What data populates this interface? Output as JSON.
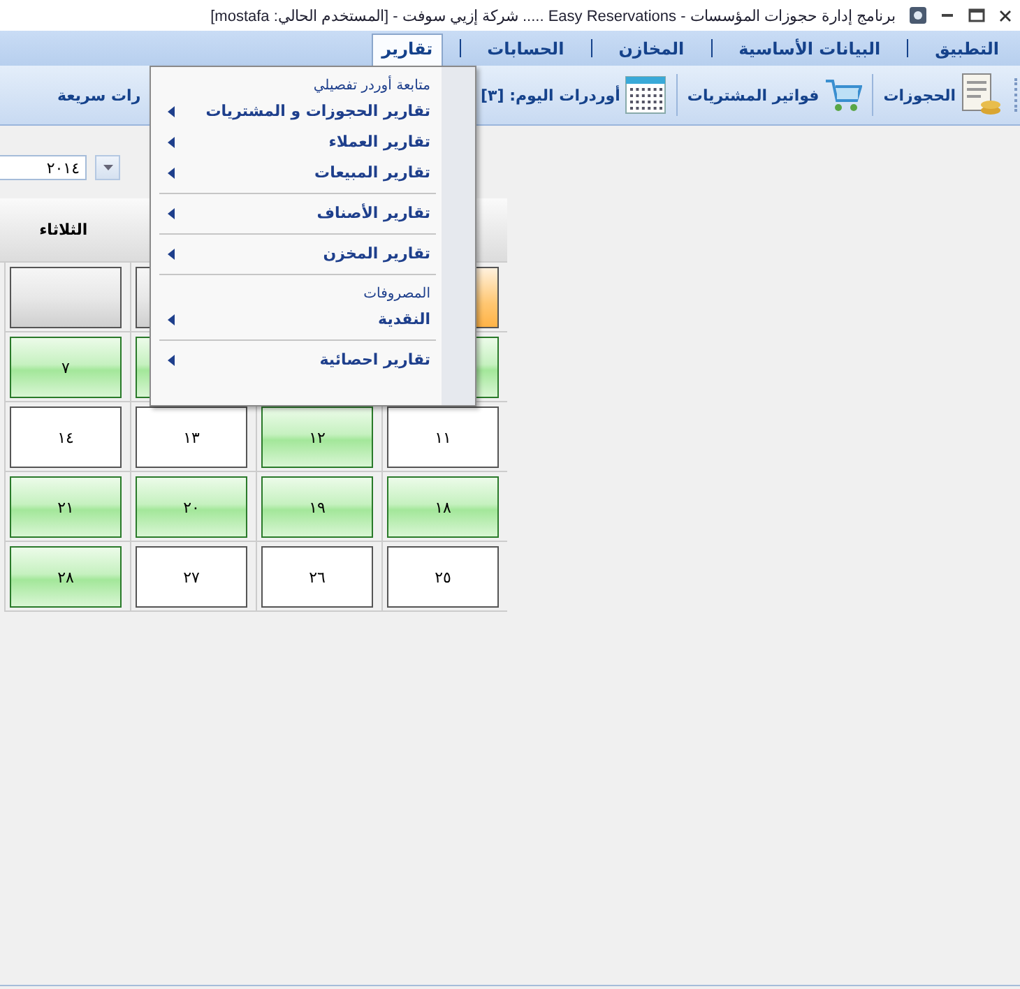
{
  "window": {
    "title": "برنامج إدارة حجوزات المؤسسات - Easy  Reservations ..... شركة إزيي سوفت - [المستخدم الحالي: mostafa]"
  },
  "menu_bar": [
    {
      "label": "التطبيق",
      "selected": false
    },
    {
      "label": "البيانات الأساسية",
      "selected": false
    },
    {
      "label": "المخازن",
      "selected": false
    },
    {
      "label": "الحسابات",
      "selected": false
    },
    {
      "label": "تقارير",
      "selected": true
    }
  ],
  "toolbar": [
    {
      "label": "الحجوزات",
      "kind": "document"
    },
    {
      "label": "فواتير المشتريات",
      "kind": "cart"
    },
    {
      "label": "أوردرات اليوم: [٣]",
      "kind": "calendar"
    },
    {
      "label": "رات سريعة",
      "kind": "text"
    }
  ],
  "calendar": {
    "year": "٢٠١٤",
    "weekday": "الثلاثاء",
    "rows": [
      [
        {
          "kind": "today"
        },
        null,
        {
          "kind": "empty"
        },
        {
          "kind": "empty"
        }
      ],
      [
        {
          "kind": "available"
        },
        null,
        {
          "kind": "available"
        },
        {
          "kind": "available",
          "day": "٧"
        }
      ],
      [
        {
          "kind": "plain",
          "day": "١١"
        },
        {
          "kind": "available",
          "day": "١٢"
        },
        {
          "kind": "plain",
          "day": "١٣"
        },
        {
          "kind": "plain",
          "day": "١٤"
        }
      ],
      [
        {
          "kind": "available",
          "day": "١٨"
        },
        {
          "kind": "available",
          "day": "١٩"
        },
        {
          "kind": "available",
          "day": "٢٠"
        },
        {
          "kind": "available",
          "day": "٢١"
        }
      ],
      [
        {
          "kind": "plain",
          "day": "٢٥"
        },
        {
          "kind": "plain",
          "day": "٢٦"
        },
        {
          "kind": "plain",
          "day": "٢٧"
        },
        {
          "kind": "available",
          "day": "٢٨"
        }
      ]
    ]
  },
  "reports_menu": [
    {
      "kind": "heading",
      "label": "متابعة أوردر تفصيلي"
    },
    {
      "kind": "submenu",
      "label": "تقارير الحجوزات و المشتريات"
    },
    {
      "kind": "submenu",
      "label": "تقارير العملاء"
    },
    {
      "kind": "submenu",
      "label": "تقارير المبيعات"
    },
    {
      "kind": "separator"
    },
    {
      "kind": "submenu",
      "label": "تقارير الأصناف"
    },
    {
      "kind": "separator"
    },
    {
      "kind": "submenu",
      "label": "تقارير المخزن"
    },
    {
      "kind": "separator"
    },
    {
      "kind": "heading",
      "label": "المصروفات"
    },
    {
      "kind": "submenu",
      "label": "النقدية"
    },
    {
      "kind": "separator"
    },
    {
      "kind": "submenu",
      "label": "تقارير احصائية"
    }
  ]
}
